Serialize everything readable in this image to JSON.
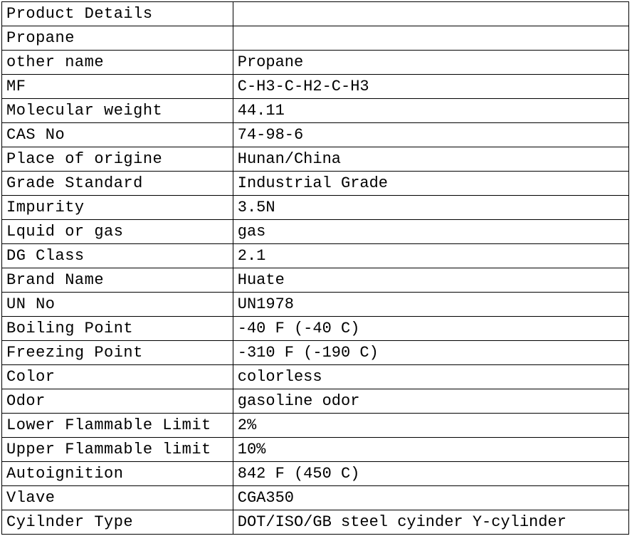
{
  "chart_data": {
    "type": "table",
    "title": "Product Details",
    "rows": [
      {
        "label": "Product Details",
        "value": ""
      },
      {
        "label": "Propane",
        "value": ""
      },
      {
        "label": "other name",
        "value": "Propane"
      },
      {
        "label": "MF",
        "value": "C-H3-C-H2-C-H3"
      },
      {
        "label": "Molecular weight",
        "value": "44.11"
      },
      {
        "label": "CAS No",
        "value": "74-98-6"
      },
      {
        "label": "Place of origine",
        "value": "Hunan/China"
      },
      {
        "label": "Grade Standard",
        "value": "Industrial Grade"
      },
      {
        "label": "Impurity",
        "value": "3.5N"
      },
      {
        "label": "Lquid or gas",
        "value": "gas"
      },
      {
        "label": "DG Class",
        "value": "2.1"
      },
      {
        "label": "Brand Name",
        "value": "Huate"
      },
      {
        "label": "UN No",
        "value": " UN1978"
      },
      {
        "label": "Boiling Point",
        "value": " -40 F (-40 C)"
      },
      {
        "label": "Freezing Point",
        "value": "-310 F (-190 C)"
      },
      {
        "label": "Color",
        "value": " colorless"
      },
      {
        "label": "Odor",
        "value": "gasoline odor"
      },
      {
        "label": "Lower Flammable Limit",
        "value": "2%"
      },
      {
        "label": "Upper Flammable limit",
        "value": "10%"
      },
      {
        "label": "Autoignition",
        "value": " 842 F (450 C)"
      },
      {
        "label": "Vlave",
        "value": "CGA350"
      },
      {
        "label": "Cyilnder Type",
        "value": "DOT/ISO/GB steel cyinder  Y-cylinder"
      }
    ]
  }
}
